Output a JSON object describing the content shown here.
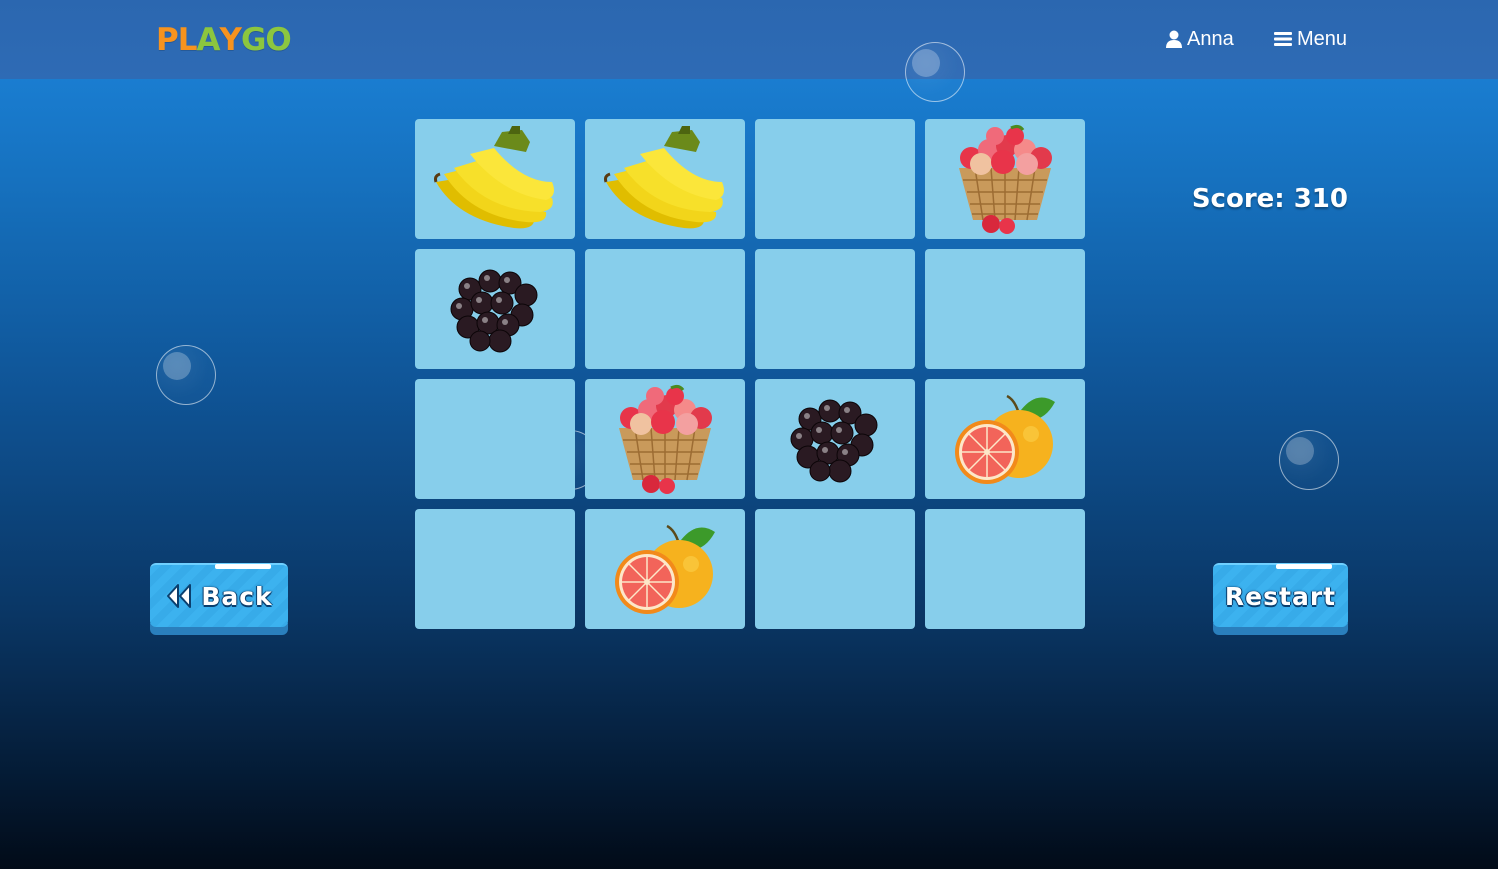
{
  "header": {
    "logo_letters": [
      {
        "ch": "P",
        "color": "#f7931e"
      },
      {
        "ch": "L",
        "color": "#f7931e"
      },
      {
        "ch": "A",
        "color": "#8cc63f"
      },
      {
        "ch": "Y",
        "color": "#f7931e"
      },
      {
        "ch": "G",
        "color": "#8cc63f"
      },
      {
        "ch": "O",
        "color": "#8cc63f"
      }
    ],
    "user_name": "Anna",
    "user_icon": "user-icon",
    "menu_label": "Menu",
    "menu_icon": "hamburger-icon"
  },
  "score_text": "Score: 310",
  "buttons": {
    "back_label": "Back",
    "back_icon": "double-chevron-left-icon",
    "restart_label": "Restart"
  },
  "board": {
    "rows": 4,
    "cols": 4,
    "card_color": "#87ceeb",
    "cards": [
      "banana",
      "banana",
      "",
      "apple-basket",
      "blackberry",
      "",
      "",
      "",
      "",
      "apple-basket",
      "blackberry",
      "grapefruit",
      "",
      "grapefruit",
      "",
      ""
    ]
  }
}
